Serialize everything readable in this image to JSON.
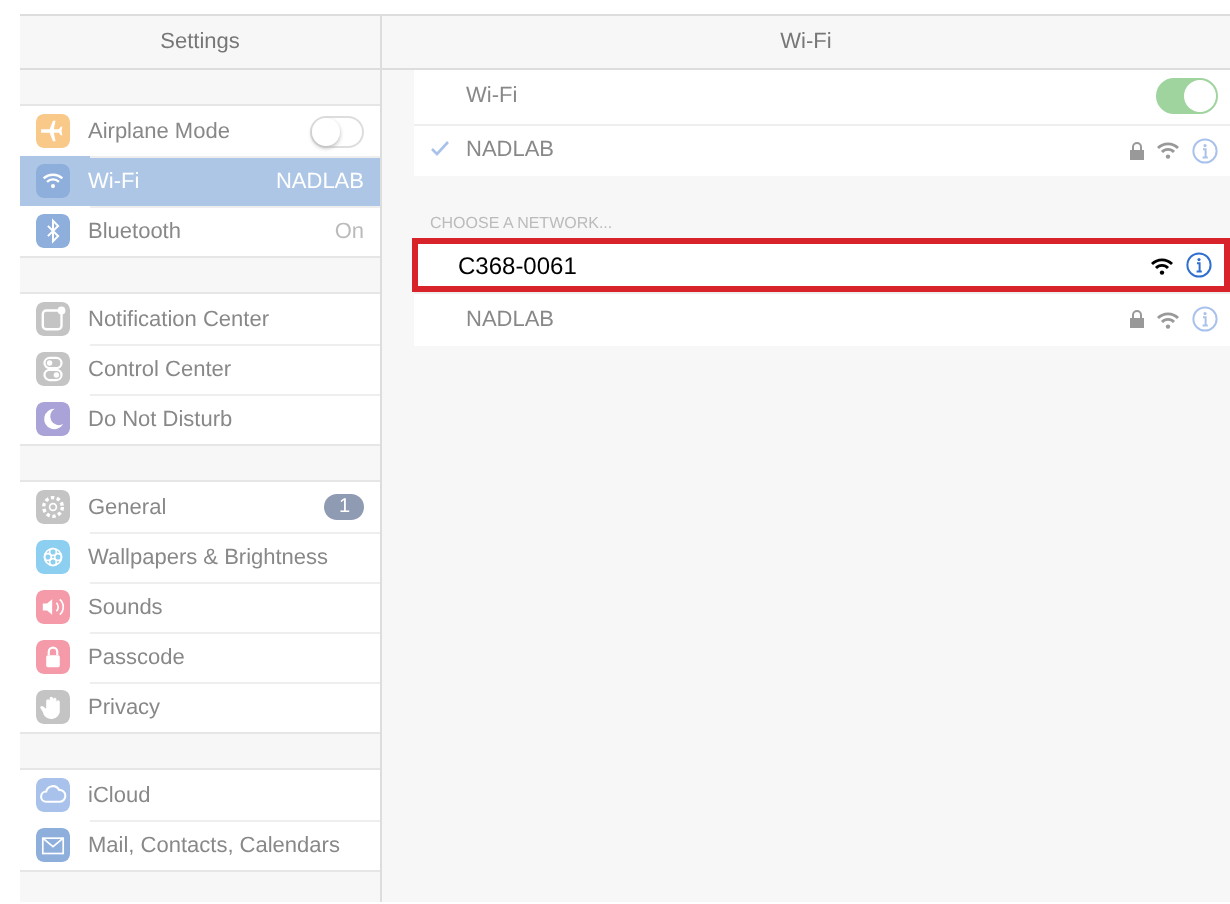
{
  "sidebar": {
    "title": "Settings",
    "groups": [
      {
        "items": [
          {
            "color": "#f9c98a",
            "label": "Airplane Mode",
            "kind": "toggle",
            "on": false,
            "selected": false
          },
          {
            "color": "#8eaedc",
            "label": "Wi-Fi",
            "kind": "value",
            "value": "NADLAB",
            "selected": true
          },
          {
            "color": "#8eaedc",
            "label": "Bluetooth",
            "kind": "value",
            "value": "On",
            "selected": false
          }
        ]
      },
      {
        "items": [
          {
            "color": "#c4c4c4",
            "label": "Notification Center",
            "kind": "plain",
            "selected": false
          },
          {
            "color": "#c4c4c4",
            "label": "Control Center",
            "kind": "plain",
            "selected": false
          },
          {
            "color": "#a9a3d8",
            "label": "Do Not Disturb",
            "kind": "plain",
            "selected": false
          }
        ]
      },
      {
        "items": [
          {
            "color": "#c4c4c4",
            "label": "General",
            "kind": "badge",
            "badge": "1",
            "selected": false
          },
          {
            "color": "#8ccff0",
            "label": "Wallpapers & Brightness",
            "kind": "plain",
            "selected": false
          },
          {
            "color": "#f49aa8",
            "label": "Sounds",
            "kind": "plain",
            "selected": false
          },
          {
            "color": "#f49aa8",
            "label": "Passcode",
            "kind": "plain",
            "selected": false
          },
          {
            "color": "#c4c4c4",
            "label": "Privacy",
            "kind": "plain",
            "selected": false
          }
        ]
      },
      {
        "items": [
          {
            "color": "#a9c2ec",
            "label": "iCloud",
            "kind": "plain",
            "selected": false
          },
          {
            "color": "#8eaedc",
            "label": "Mail, Contacts, Calendars",
            "kind": "plain",
            "selected": false
          }
        ]
      }
    ]
  },
  "detail": {
    "title": "Wi-Fi",
    "wifi": {
      "label": "Wi-Fi",
      "on": true
    },
    "current": {
      "name": "NADLAB",
      "checked": true,
      "locked": true
    },
    "section_header": "CHOOSE A NETWORK...",
    "networks": [
      {
        "name": "C368-0061",
        "locked": false,
        "highlighted": true
      },
      {
        "name": "NADLAB",
        "locked": true,
        "highlighted": false
      }
    ]
  }
}
